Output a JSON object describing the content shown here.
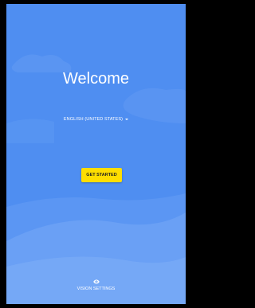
{
  "welcome": {
    "title": "Welcome"
  },
  "language": {
    "selected": "ENGLISH (UNITED STATES)"
  },
  "actions": {
    "get_started_label": "GET STARTED"
  },
  "accessibility": {
    "vision_settings_label": "VISION SETTINGS",
    "icon": "eye-icon"
  },
  "colors": {
    "background": "#4f8ef1",
    "button": "#ffde00",
    "text": "#ffffff"
  }
}
